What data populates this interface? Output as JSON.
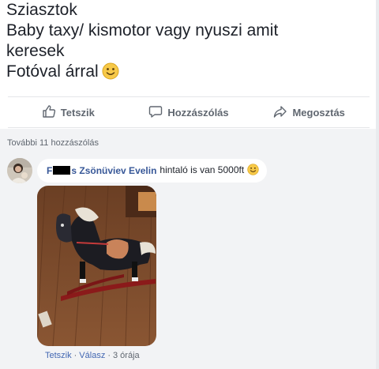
{
  "post": {
    "lines": [
      "Sziasztok",
      "Baby taxy/ kismotor vagy nyuszi amit",
      "keresek",
      "Fotóval árral"
    ],
    "emoji": "slightly-smiling-face-emoji"
  },
  "actions": {
    "like": "Tetszik",
    "comment": "Hozzászólás",
    "share": "Megosztás"
  },
  "comments": {
    "more_label": "További 11 hozzászólás",
    "items": [
      {
        "author_first_visible_start": "F",
        "author_first_visible_end": "s",
        "author_rest": "Zsönüviev Evelin",
        "text": "hintaló is van 5000ft",
        "photo": "rocking-horse-photo",
        "actions": {
          "like": "Tetszik",
          "reply": "Válasz",
          "time": "3 órája"
        }
      }
    ]
  },
  "colors": {
    "link": "#385898",
    "muted": "#606770",
    "background_comments": "#f2f3f5"
  }
}
